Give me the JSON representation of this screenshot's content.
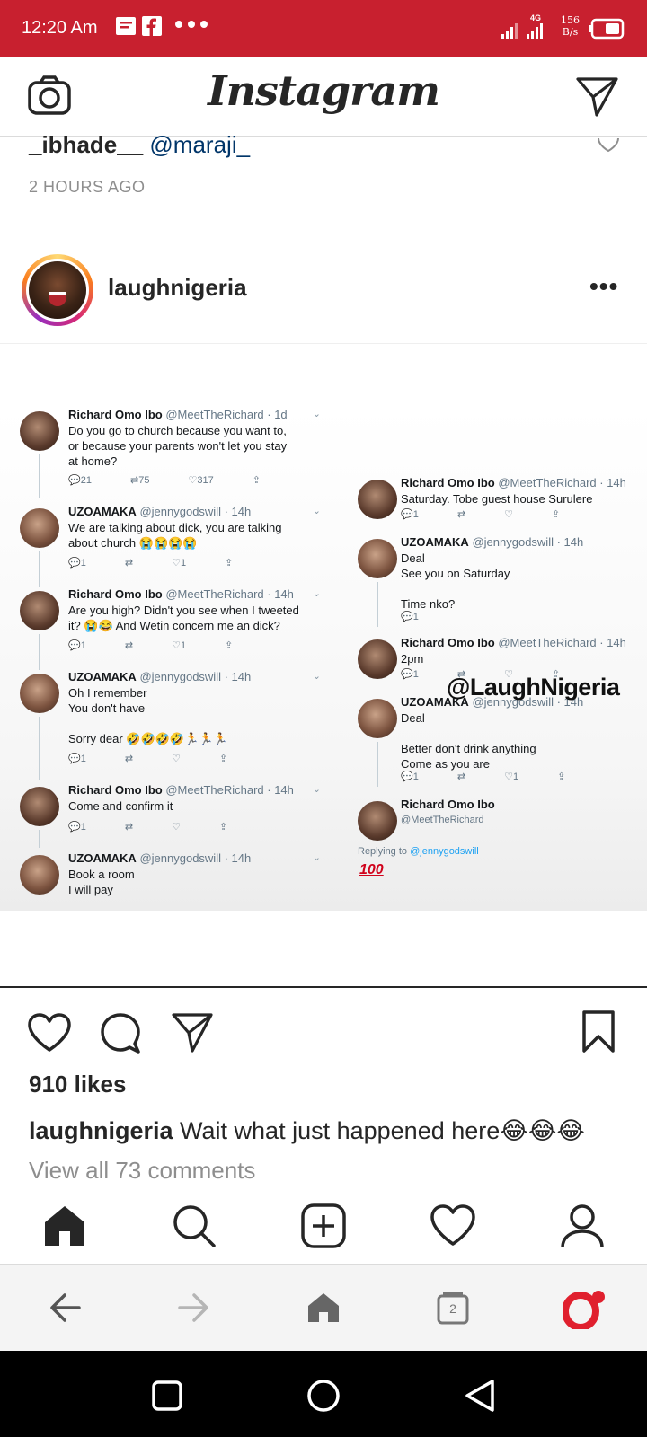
{
  "status_bar": {
    "time": "12:20 Am",
    "network_type": "4G",
    "speed_value": "156",
    "speed_unit": "B/s",
    "background": "#c8202f"
  },
  "header": {
    "brand": "Instagram",
    "left_icon": "camera-icon",
    "right_icon": "direct-send-icon"
  },
  "previous_post": {
    "caption_user": "_ibhade__",
    "caption_mention": "@maraji_",
    "time": "2 HOURS AGO"
  },
  "post": {
    "username": "laughnigeria",
    "more_label": "•••",
    "likes": "910 likes",
    "caption_user": "laughnigeria",
    "caption_text": "Wait what just happened here😂😂😂",
    "view_comments": "View all 73 comments"
  },
  "tweets_left": [
    {
      "name": "Richard Omo Ibo",
      "handle": "@MeetTheRichard · 1d",
      "body": "Do you go to church because you want to,\nor because your parents won't let you stay\nat home?",
      "actions": "💬21 ⇄75 ♡317 ⇪"
    },
    {
      "name": "UZOAMAKA",
      "handle": "@jennygodswill · 14h",
      "body": "We are talking about dick, you are talking\nabout church 😭😭😭😭",
      "actions": "💬1 ⇄ ♡1 ⇪"
    },
    {
      "name": "Richard Omo Ibo",
      "handle": "@MeetTheRichard · 14h",
      "body": "Are you high? Didn't you see when I tweeted\nit? 😭😂 And Wetin concern me an dick?",
      "actions": "💬1 ⇄ ♡1 ⇪"
    },
    {
      "name": "UZOAMAKA",
      "handle": "@jennygodswill · 14h",
      "body": "Oh I remember\nYou don't have\n\nSorry dear 🤣🤣🤣🤣🏃🏃🏃",
      "actions": "💬1 ⇄ ♡ ⇪"
    },
    {
      "name": "Richard Omo Ibo",
      "handle": "@MeetTheRichard · 14h",
      "body": "Come and confirm it",
      "actions": "💬1 ⇄ ♡ ⇪"
    },
    {
      "name": "UZOAMAKA",
      "handle": "@jennygodswill · 14h",
      "body": "Book a room\nI will pay",
      "actions": ""
    }
  ],
  "tweets_right": [
    {
      "name": "Richard Omo Ibo",
      "handle": "@MeetTheRichard · 14h",
      "body": "Saturday. Tobe guest house Surulere",
      "actions": "💬1 ⇄ ♡ ⇪"
    },
    {
      "name": "UZOAMAKA",
      "handle": "@jennygodswill · 14h",
      "body": "Deal\nSee you on Saturday\n\nTime nko?",
      "actions": "💬1"
    },
    {
      "name": "Richard Omo Ibo",
      "handle": "@MeetTheRichard · 14h",
      "body": "2pm",
      "actions": "💬1 ⇄ ♡ ⇪"
    },
    {
      "name": "UZOAMAKA",
      "handle": "@jennygodswill · 14h",
      "body": "Deal\n\nBetter don't drink anything\nCome as you are",
      "actions": "💬1 ⇄ ♡1 ⇪"
    },
    {
      "name": "Richard Omo Ibo",
      "handle": "@MeetTheRichard",
      "body": "",
      "actions": ""
    }
  ],
  "image_overlay": {
    "watermark": "@LaughNigeria",
    "reply_prefix": "Replying to",
    "reply_handle": "@jennygodswill",
    "emoji": "100"
  },
  "tabbar": {
    "items": [
      "home-icon",
      "search-icon",
      "new-post-icon",
      "activity-heart-icon",
      "profile-icon"
    ]
  },
  "browser_bar": {
    "tab_count": "2"
  }
}
